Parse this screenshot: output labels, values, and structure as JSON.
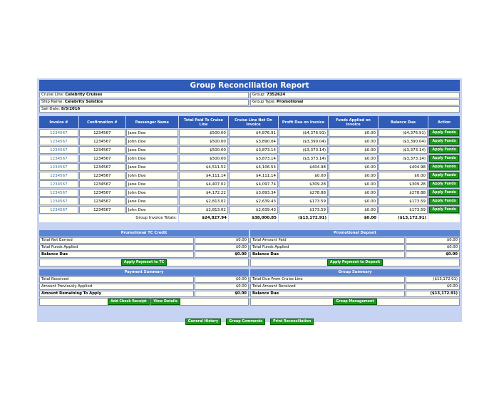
{
  "title": "Group Reconciliation Report",
  "info": {
    "cruise_line_label": "Cruise Line:",
    "cruise_line": "Celebrity Cruises",
    "group_label": "Group:",
    "group": "7352624",
    "ship_label": "Ship Name:",
    "ship": "Celebrity Solstice",
    "group_type_label": "Group Type:",
    "group_type": "Promotional",
    "sail_date_label": "Sail Date:",
    "sail_date": "8/5/2016"
  },
  "table": {
    "headers": [
      "Invoice #",
      "Confirmation #",
      "Passenger Name",
      "Total Paid To Cruise Line",
      "Cruise Line Net On Invoice",
      "Profit Due on Invoice",
      "Funds Applied on Invoice",
      "Balance Due",
      "Action"
    ],
    "rows": [
      {
        "invoice": "1234567",
        "confirmation": "1234567",
        "passenger": "Jane Doe",
        "paid": "$500.00",
        "net": "$4,876.91",
        "profit": "($4,376.91)",
        "applied": "$0.00",
        "balance": "($4,376.91)",
        "action": "Apply Funds"
      },
      {
        "invoice": "1234567",
        "confirmation": "1234567",
        "passenger": "John Doe",
        "paid": "$500.00",
        "net": "$3,890.04",
        "profit": "($3,390.04)",
        "applied": "$0.00",
        "balance": "($3,390.04)",
        "action": "Apply Funds"
      },
      {
        "invoice": "1234567",
        "confirmation": "1234567",
        "passenger": "Jane Doe",
        "paid": "$500.00",
        "net": "$3,873.14",
        "profit": "($3,373.14)",
        "applied": "$0.00",
        "balance": "($3,373.14)",
        "action": "Apply Funds"
      },
      {
        "invoice": "1234567",
        "confirmation": "1234567",
        "passenger": "John Doe",
        "paid": "$500.00",
        "net": "$3,873.14",
        "profit": "($3,373.14)",
        "applied": "$0.00",
        "balance": "($3,373.14)",
        "action": "Apply Funds"
      },
      {
        "invoice": "1234567",
        "confirmation": "1234567",
        "passenger": "Jane Doe",
        "paid": "$4,511.52",
        "net": "$4,106.54",
        "profit": "$404.98",
        "applied": "$0.00",
        "balance": "$404.98",
        "action": "Apply Funds"
      },
      {
        "invoice": "1234567",
        "confirmation": "1234567",
        "passenger": "John Doe",
        "paid": "$4,111.14",
        "net": "$4,111.14",
        "profit": "$0.00",
        "applied": "$0.00",
        "balance": "$0.00",
        "action": "Apply Funds"
      },
      {
        "invoice": "1234567",
        "confirmation": "1234567",
        "passenger": "Jane Doe",
        "paid": "$4,407.02",
        "net": "$4,097.74",
        "profit": "$309.28",
        "applied": "$0.00",
        "balance": "$309.28",
        "action": "Apply Funds"
      },
      {
        "invoice": "1234567",
        "confirmation": "1234567",
        "passenger": "John Doe",
        "paid": "$4,172.22",
        "net": "$3,893.34",
        "profit": "$278.88",
        "applied": "$0.00",
        "balance": "$278.88",
        "action": "Apply Funds"
      },
      {
        "invoice": "1234567",
        "confirmation": "1234567",
        "passenger": "Jane Doe",
        "paid": "$2,813.02",
        "net": "$2,639.43",
        "profit": "$173.59",
        "applied": "$0.00",
        "balance": "$173.59",
        "action": "Apply Funds"
      },
      {
        "invoice": "1234567",
        "confirmation": "1234567",
        "passenger": "John Doe",
        "paid": "$2,813.02",
        "net": "$2,639.43",
        "profit": "$173.59",
        "applied": "$0.00",
        "balance": "$173.59",
        "action": "Apply Funds"
      }
    ],
    "totals": {
      "label": "Group Invoice Totals:",
      "paid": "$24,827.94",
      "net": "$38,000.85",
      "profit": "($13,172.91)",
      "applied": "$0.00",
      "balance": "($13,172.91)"
    }
  },
  "promo_tc": {
    "title": "Promotional TC Credit",
    "rows": [
      {
        "label": "Total Net Earned",
        "value": "$0.00"
      },
      {
        "label": "Total Funds Applied",
        "value": "$0.00"
      },
      {
        "label": "Balance Due",
        "value": "$0.00"
      }
    ],
    "button": "Apply Payment to TC"
  },
  "promo_deposit": {
    "title": "Promotional Deposit",
    "rows": [
      {
        "label": "Total Amount Paid",
        "value": "$0.00"
      },
      {
        "label": "Total Funds Applied",
        "value": "$0.00"
      },
      {
        "label": "Balance Due",
        "value": "$0.00"
      }
    ],
    "button": "Apply Payment to Deposit"
  },
  "payment_summary": {
    "title": "Payment Summary",
    "rows": [
      {
        "label": "Total Received",
        "value": "$0.00"
      },
      {
        "label": "Amount Previously Applied",
        "value": "$0.00"
      },
      {
        "label": "Amount Remaining To Apply",
        "value": "$0.00"
      }
    ],
    "buttons": [
      "Add Check Receipt",
      "View Details"
    ]
  },
  "group_summary": {
    "title": "Group Summary",
    "rows": [
      {
        "label": "Total Due From Cruise Line",
        "value": "($13,172.91)"
      },
      {
        "label": "Total Amount Received",
        "value": "$0.00"
      },
      {
        "label": "Balance Due",
        "value": "($13,172.91)"
      }
    ],
    "button": "Group Management"
  },
  "bottom_buttons": [
    "General History",
    "Group Comments",
    "Print Reconciliation"
  ],
  "colors": {
    "header_blue": "#2f5cb8",
    "panel_blue": "#5a84cf",
    "background_blue": "#c6d3f3",
    "button_green": "#1a9a1a",
    "cell_cream": "#fffff4"
  }
}
